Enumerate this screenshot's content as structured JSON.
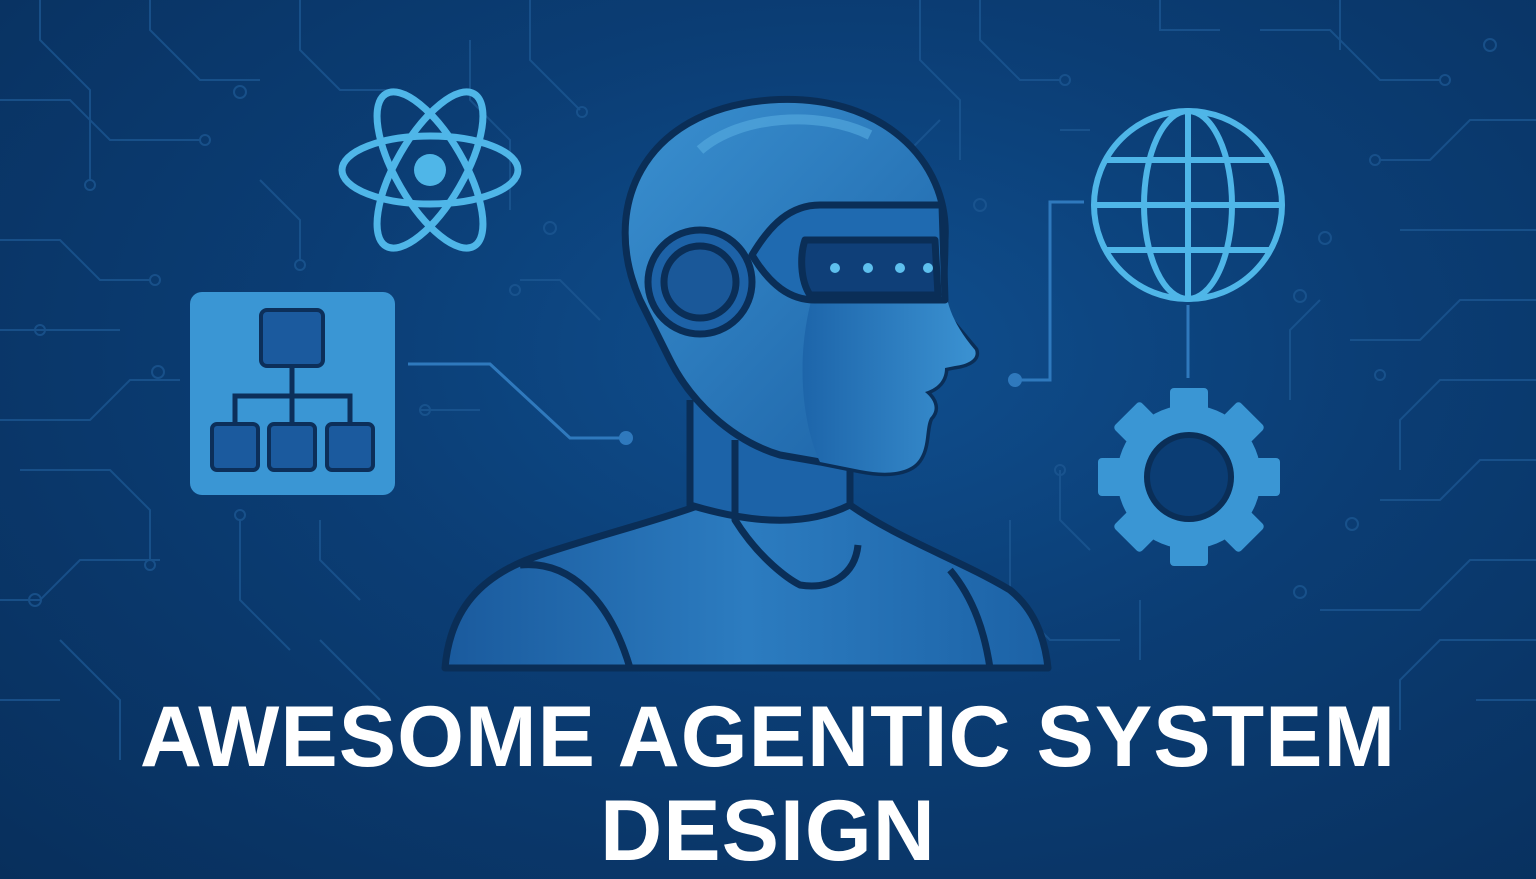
{
  "title": {
    "line1": "AWESOME AGENTIC SYSTEM",
    "line2": "DESIGN"
  },
  "colors": {
    "background": "#0b3d74",
    "background_dark": "#082f5c",
    "icon_light": "#4fb6e8",
    "icon_mid": "#2e8ccc",
    "figure_fill": "#1f6fb3",
    "figure_outline": "#0a2e57",
    "circuit": "#1e5a95",
    "title_text": "#ffffff"
  },
  "icons": [
    "atom-icon",
    "hierarchy-icon",
    "globe-icon",
    "gear-icon",
    "ai-robot-head-icon"
  ]
}
